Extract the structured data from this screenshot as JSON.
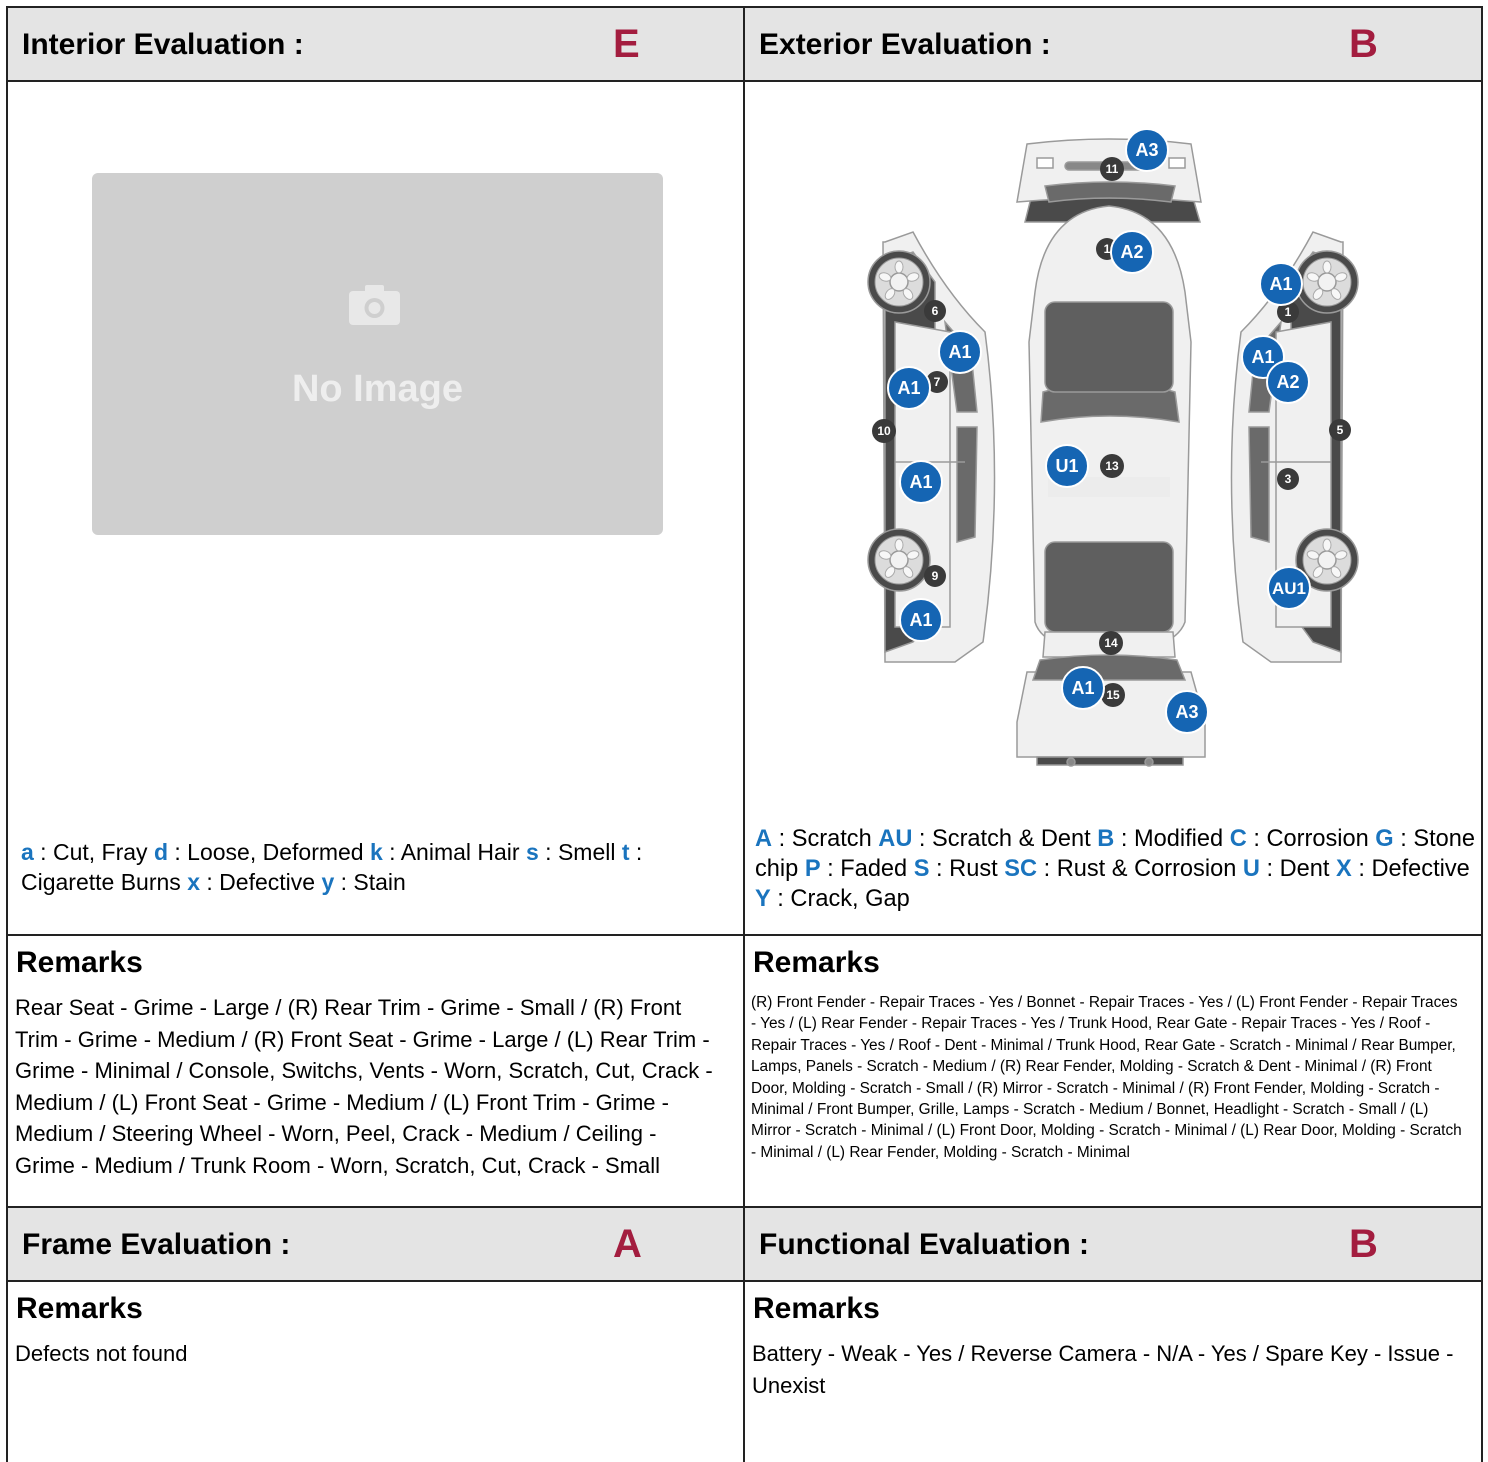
{
  "interior": {
    "title": "Interior Evaluation :",
    "grade": "E",
    "no_image": "No Image",
    "legend": [
      {
        "code": "a",
        "desc": "Cut, Fray"
      },
      {
        "code": "d",
        "desc": "Loose, Deformed"
      },
      {
        "code": "k",
        "desc": "Animal Hair"
      },
      {
        "code": "s",
        "desc": "Smell"
      },
      {
        "code": "t",
        "desc": "Cigarette Burns"
      },
      {
        "code": "x",
        "desc": "Defective"
      },
      {
        "code": "y",
        "desc": "Stain"
      }
    ],
    "remarks_heading": "Remarks",
    "remarks": "Rear Seat - Grime - Large / (R) Rear Trim - Grime - Small / (R) Front Trim - Grime - Medium / (R) Front Seat - Grime - Large / (L) Rear Trim - Grime - Minimal / Console, Switchs, Vents - Worn, Scratch, Cut, Crack - Medium / (L) Front Seat - Grime - Medium / (L) Front Trim - Grime - Medium / Steering Wheel - Worn, Peel, Crack - Medium / Ceiling - Grime - Medium / Trunk Room - Worn, Scratch, Cut, Crack - Small"
  },
  "exterior": {
    "title": "Exterior Evaluation :",
    "grade": "B",
    "legend": [
      {
        "code": "A",
        "desc": "Scratch"
      },
      {
        "code": "AU",
        "desc": "Scratch & Dent"
      },
      {
        "code": "B",
        "desc": "Modified"
      },
      {
        "code": "C",
        "desc": "Corrosion"
      },
      {
        "code": "G",
        "desc": "Stone chip"
      },
      {
        "code": "P",
        "desc": "Faded"
      },
      {
        "code": "S",
        "desc": "Rust"
      },
      {
        "code": "SC",
        "desc": "Rust & Corrosion"
      },
      {
        "code": "U",
        "desc": "Dent"
      },
      {
        "code": "X",
        "desc": "Defective"
      },
      {
        "code": "Y",
        "desc": "Crack, Gap"
      }
    ],
    "remarks_heading": "Remarks",
    "remarks": "(R) Front Fender - Repair Traces - Yes / Bonnet - Repair Traces - Yes / (L) Front Fender - Repair Traces - Yes / (L) Rear Fender - Repair Traces - Yes / Trunk Hood, Rear Gate - Repair Traces - Yes / Roof - Repair Traces - Yes / Roof - Dent - Minimal / Trunk Hood, Rear Gate - Scratch - Minimal / Rear Bumper, Lamps, Panels - Scratch - Medium / (R) Rear Fender, Molding - Scratch & Dent - Minimal / (R) Front Door, Molding - Scratch - Small / (R) Mirror - Scratch - Minimal / (R) Front Fender, Molding - Scratch - Minimal / Front Bumper, Grille, Lamps - Scratch - Medium / Bonnet, Headlight - Scratch - Small / (L) Mirror - Scratch - Minimal / (L) Front Door, Molding - Scratch - Minimal / (L) Rear Door, Molding - Scratch - Minimal / (L) Rear Fender, Molding - Scratch - Minimal",
    "panel_numbers": [
      "1",
      "3",
      "5",
      "6",
      "7",
      "9",
      "10",
      "11",
      "13",
      "14",
      "15",
      "1"
    ],
    "damage_marks": [
      "A3",
      "A2",
      "A1",
      "A1",
      "A1",
      "A1",
      "A1",
      "A1",
      "A2",
      "U1",
      "AU1",
      "A1",
      "A3"
    ]
  },
  "frame": {
    "title": "Frame Evaluation :",
    "grade": "A",
    "remarks_heading": "Remarks",
    "remarks": "Defects not found"
  },
  "functional": {
    "title": "Functional Evaluation :",
    "grade": "B",
    "remarks_heading": "Remarks",
    "remarks": "Battery - Weak - Yes / Reverse Camera - N/A - Yes / Spare Key - Issue - Unexist"
  },
  "colors": {
    "grade": "#a31d3f",
    "code": "#1a74be",
    "header_bg": "#e4e4e4",
    "marker": "#1565b3",
    "panel_marker": "#3a3a3a"
  }
}
